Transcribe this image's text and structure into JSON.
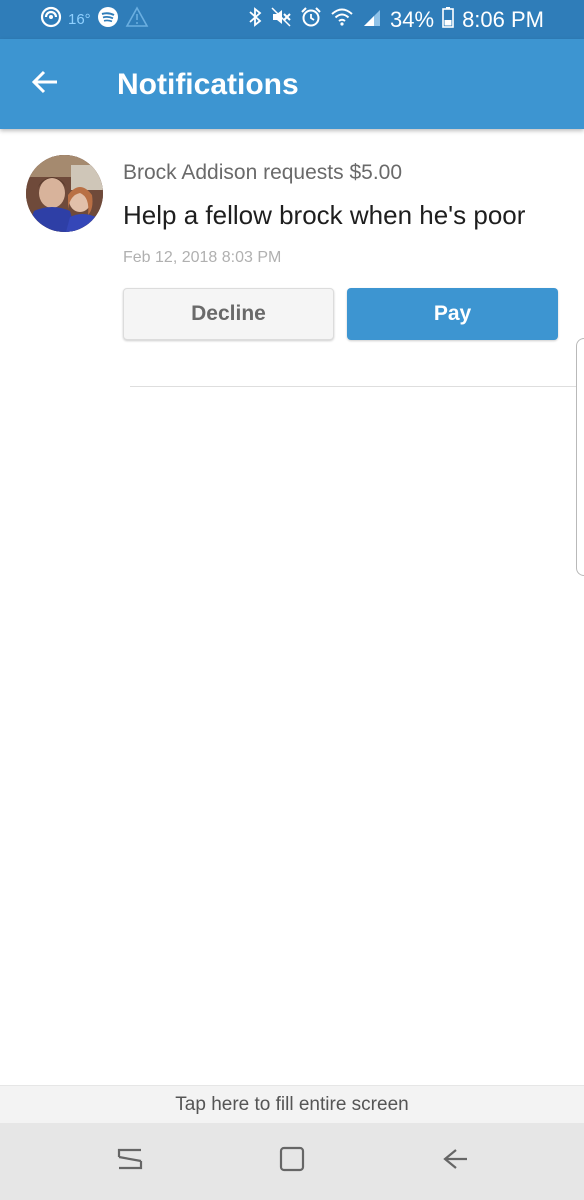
{
  "status_bar": {
    "temperature": "16°",
    "battery": "34%",
    "time": "8:06 PM"
  },
  "app_bar": {
    "title": "Notifications",
    "back_icon": "arrow-left-icon"
  },
  "notification": {
    "title": "Brock Addison requests $5.00",
    "message": "Help a fellow brock when he's poor",
    "timestamp": "Feb 12, 2018 8:03 PM",
    "decline_label": "Decline",
    "pay_label": "Pay"
  },
  "fill_screen": {
    "label": "Tap here to fill entire screen"
  },
  "nav_bar": {
    "recents_icon": "recent-apps-icon",
    "home_icon": "home-icon",
    "back_icon": "back-icon"
  },
  "colors": {
    "status_bar": "#2f7db9",
    "app_bar": "#3d95d1",
    "pay_button": "#3d95d1",
    "decline_button": "#f5f5f5"
  }
}
